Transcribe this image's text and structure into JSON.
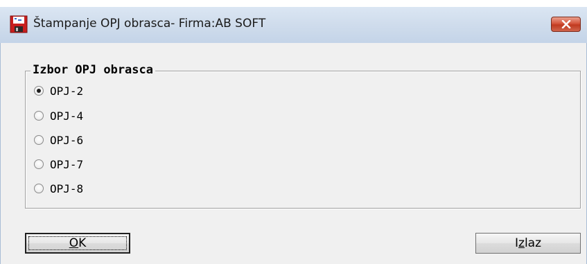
{
  "window": {
    "title": "Štampanje OPJ obrasca- Firma:AB SOFT",
    "icon": "floppy-disk-app-icon",
    "close_icon": "close-x-icon"
  },
  "group": {
    "legend": "Izbor OPJ obrasca",
    "options": [
      {
        "label": "OPJ-2",
        "selected": true
      },
      {
        "label": "OPJ-4",
        "selected": false
      },
      {
        "label": "OPJ-6",
        "selected": false
      },
      {
        "label": "OPJ-7",
        "selected": false
      },
      {
        "label": "OPJ-8",
        "selected": false
      }
    ]
  },
  "buttons": {
    "ok": {
      "pre": "",
      "accel": "O",
      "post": "K"
    },
    "exit": {
      "pre": "I",
      "accel": "z",
      "post": "laz"
    }
  },
  "colors": {
    "titlebar": "#cfdcec",
    "client": "#f0f0f0",
    "close": "#c9472d"
  }
}
